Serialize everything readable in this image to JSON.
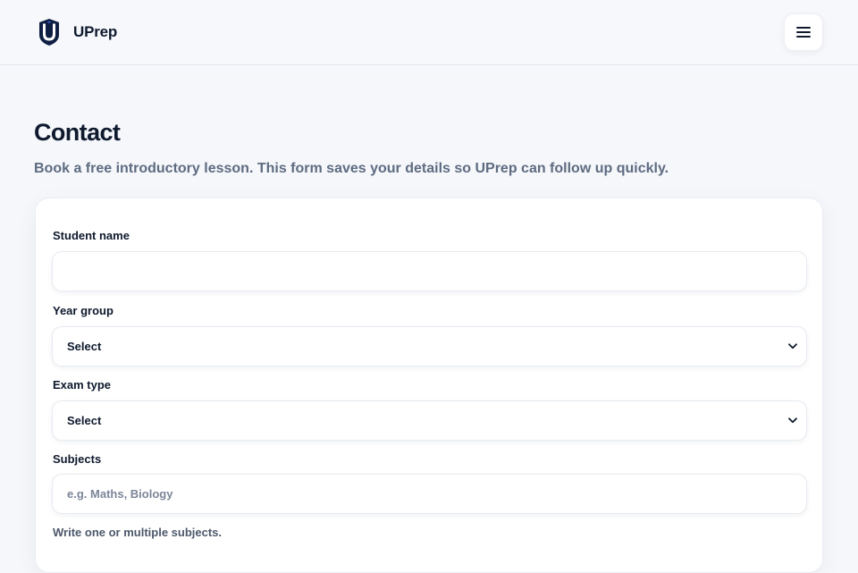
{
  "header": {
    "brand_name": "UPrep",
    "logo_icon": "shield-u-logo-icon",
    "menu_icon": "hamburger-menu-icon"
  },
  "page": {
    "title": "Contact",
    "subtitle": "Book a free introductory lesson. This form saves your details so UPrep can follow up quickly."
  },
  "form": {
    "student_name": {
      "label": "Student name",
      "value": "",
      "placeholder": ""
    },
    "year_group": {
      "label": "Year group",
      "selected": "Select"
    },
    "exam_type": {
      "label": "Exam type",
      "selected": "Select"
    },
    "subjects": {
      "label": "Subjects",
      "value": "",
      "placeholder": "e.g. Maths, Biology",
      "hint": "Write one or multiple subjects."
    }
  },
  "colors": {
    "background": "#f5f7fb",
    "text": "#0f1a2e",
    "muted": "#5e6b80",
    "logo_dark": "#0f1f44",
    "logo_accent": "#3a5bd9"
  }
}
